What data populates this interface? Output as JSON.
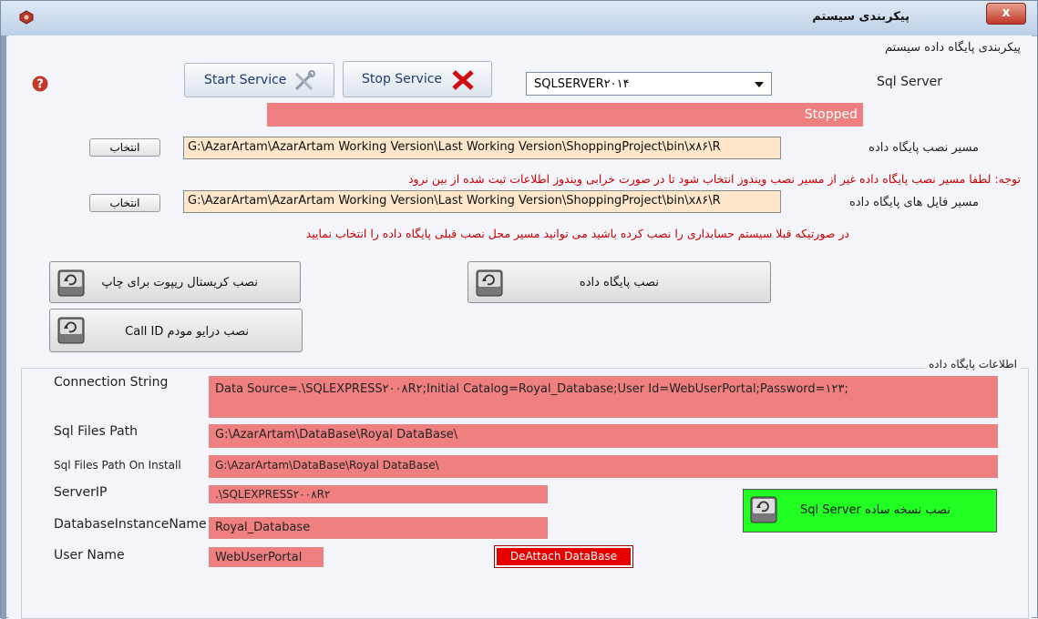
{
  "window": {
    "title": "پیکربندی سیستم",
    "close_glyph": "x"
  },
  "server_section": {
    "group_title": "پیکربندی پایگاه داده سیستم",
    "start_service_label": "Start Service",
    "stop_service_label": "Stop Service",
    "sql_server_label": "Sql Server",
    "sql_server_selected": "SQLSERVER۲۰۱۴",
    "status_text": "Stopped"
  },
  "paths": {
    "db_install_label": "مسیر نصب پایگاه داده",
    "db_install_value": "G:\\AzarArtam\\AzarArtam Working Version\\Last Working Version\\ShoppingProject\\bin\\x۸۶\\R",
    "db_files_label": "مسیر فایل های پایگاه داده",
    "db_files_value": "G:\\AzarArtam\\AzarArtam Working Version\\Last Working Version\\ShoppingProject\\bin\\x۸۶\\R",
    "choose_label": "انتخاب",
    "note1": "توجه: لطفا مسیر نصب پایگاه داده غیر از مسیر نصب ویندوز انتخاب شود تا در صورت خرابی ویندوز اطلاعات ثبت شده از بین نرود",
    "note2": "در صورتیکه قبلا سیستم حسابداری را نصب کرده باشید می توانید مسیر محل نصب قبلی پایگاه داده را انتخاب نمایید"
  },
  "install_buttons": {
    "crystal_label": "نصب کریستال ریپوت برای چاپ",
    "database_label": "نصب پایگاه داده",
    "modem_label": "نصب درایو مودم Call ID"
  },
  "db_info": {
    "group_title": "اطلاعات پایگاه داده",
    "connection_string_label": "Connection String",
    "connection_string_value": "Data Source=.\\SQLEXPRESS۲۰۰۸R۲;Initial Catalog=Royal_Database;User Id=WebUserPortal;Password=۱۲۳;",
    "sql_files_path_label": "Sql Files Path",
    "sql_files_path_value": "G:\\AzarArtam\\DataBase\\Royal DataBase\\",
    "sql_files_path_install_label": "Sql Files Path On Install",
    "sql_files_path_install_value": "G:\\AzarArtam\\DataBase\\Royal DataBase\\",
    "server_ip_label": "ServerIP",
    "server_ip_value": ".\\SQLEXPRESS۲۰۰۸R۲",
    "instance_label": "DatabaseInstanceName",
    "instance_value": "Royal_Database",
    "user_name_label": "User Name",
    "user_name_value": "WebUserPortal",
    "deattach_label": "DeAttach DataBase",
    "sql_express_label": "نصب نسخه ساده Sql Server"
  },
  "colors": {
    "field_red": "#f08080",
    "path_orange": "#fde6c9",
    "green_button": "#22ff22",
    "note_red": "#cc0000"
  },
  "icons": {
    "app": "app-icon",
    "help": "help-icon",
    "start": "wrench-screwdriver-icon",
    "stop": "red-x-icon",
    "disk": "disk-drive-icon"
  }
}
